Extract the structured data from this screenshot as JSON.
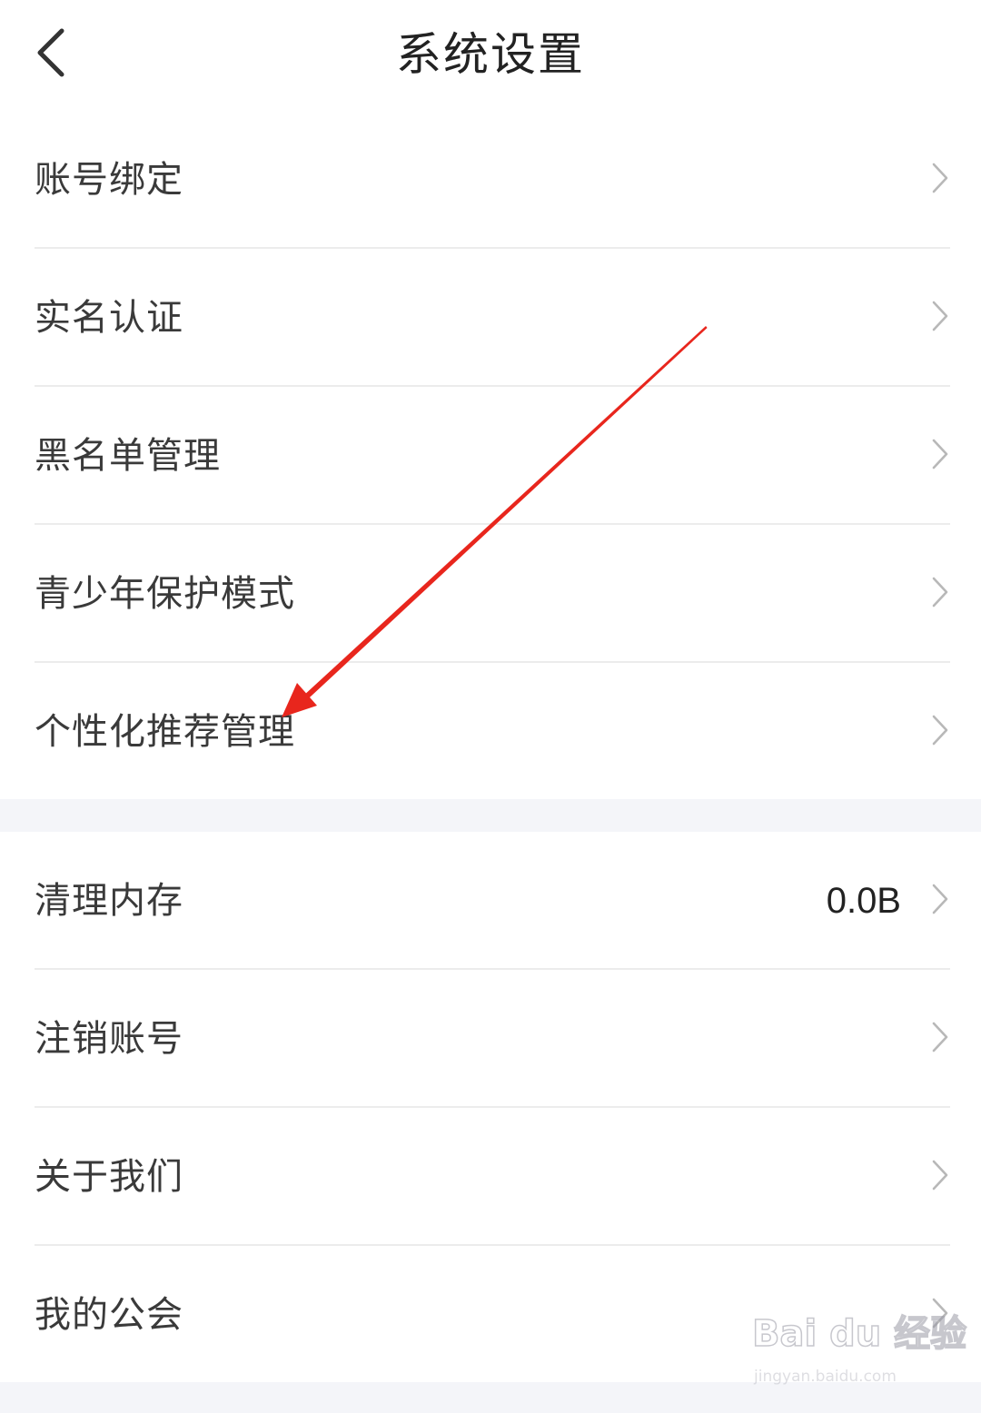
{
  "header": {
    "title": "系统设置",
    "back_icon": "chevron-left-icon"
  },
  "section_1": {
    "items": [
      {
        "label": "账号绑定"
      },
      {
        "label": "实名认证"
      },
      {
        "label": "黑名单管理"
      },
      {
        "label": "青少年保护模式"
      },
      {
        "label": "个性化推荐管理"
      }
    ]
  },
  "section_2": {
    "items": [
      {
        "label": "清理内存",
        "value": "0.0B"
      },
      {
        "label": "注销账号"
      },
      {
        "label": "关于我们"
      },
      {
        "label": "我的公会"
      }
    ]
  },
  "annotation": {
    "type": "red-arrow",
    "color": "#e8261d",
    "points_to": "个性化推荐管理"
  },
  "watermark": {
    "logo": "Bai du 经验",
    "url": "jingyan.baidu.com"
  },
  "colors": {
    "background": "#ffffff",
    "section_gap": "#f4f5f9",
    "divider": "#ececec",
    "text": "#3a3a3a",
    "chevron": "#b8b8b8"
  }
}
